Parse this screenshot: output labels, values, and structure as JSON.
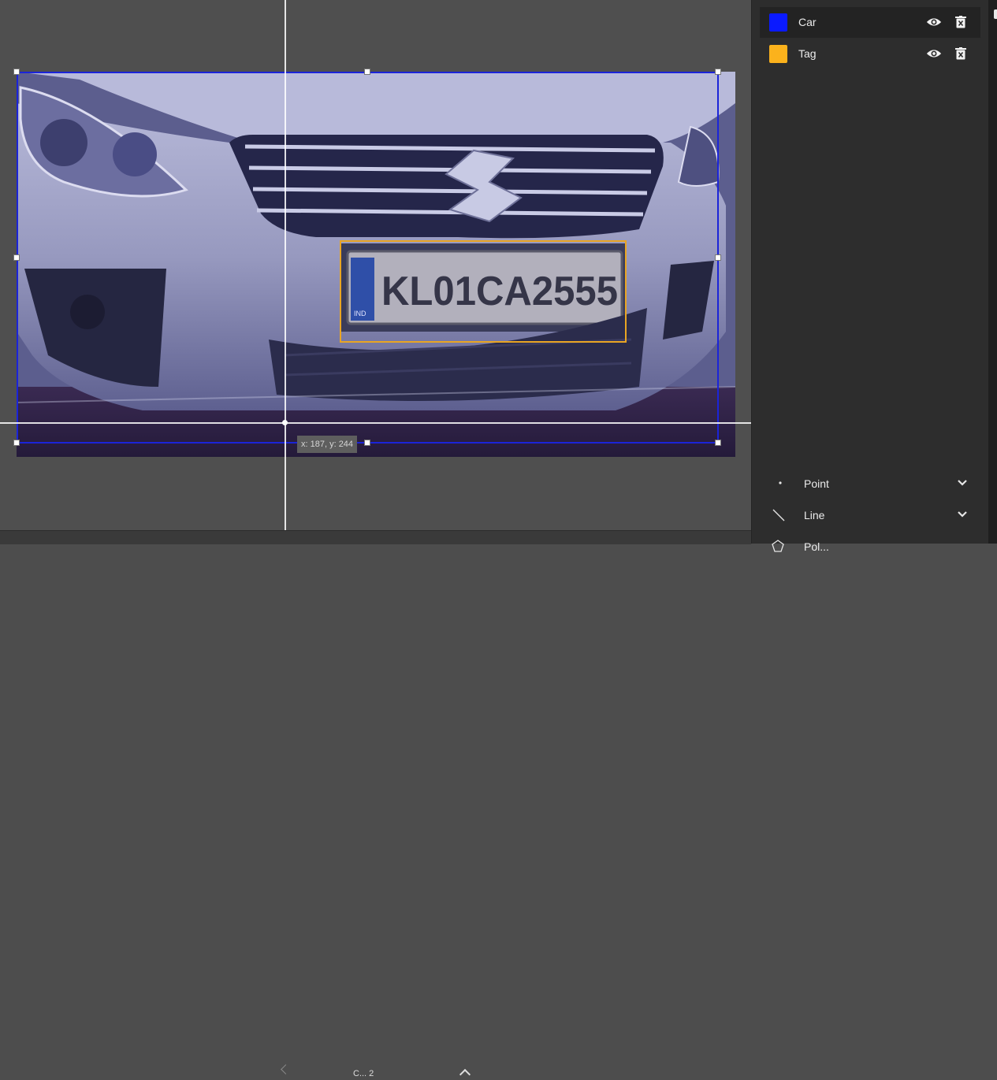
{
  "canvas": {
    "cursor_readout": "x: 187, y: 244",
    "plate_text": "KL01CA2555",
    "plate_country": "IND",
    "bottom_label": "C... 2"
  },
  "annotations": [
    {
      "label": "Car",
      "color": "#1b24d8"
    },
    {
      "label": "Tag",
      "color": "#e9a523"
    }
  ],
  "classes": [
    {
      "label": "Car",
      "color": "#0a1aff",
      "icons": [
        "eye-icon",
        "delete-icon"
      ],
      "selected": true
    },
    {
      "label": "Tag",
      "color": "#fbb21c",
      "icons": [
        "eye-icon",
        "delete-icon"
      ],
      "selected": false
    }
  ],
  "tools": [
    {
      "label": "Point",
      "icon": "point-icon"
    },
    {
      "label": "Line",
      "icon": "line-icon"
    },
    {
      "label": "Pol...",
      "icon": "polygon-icon"
    }
  ]
}
